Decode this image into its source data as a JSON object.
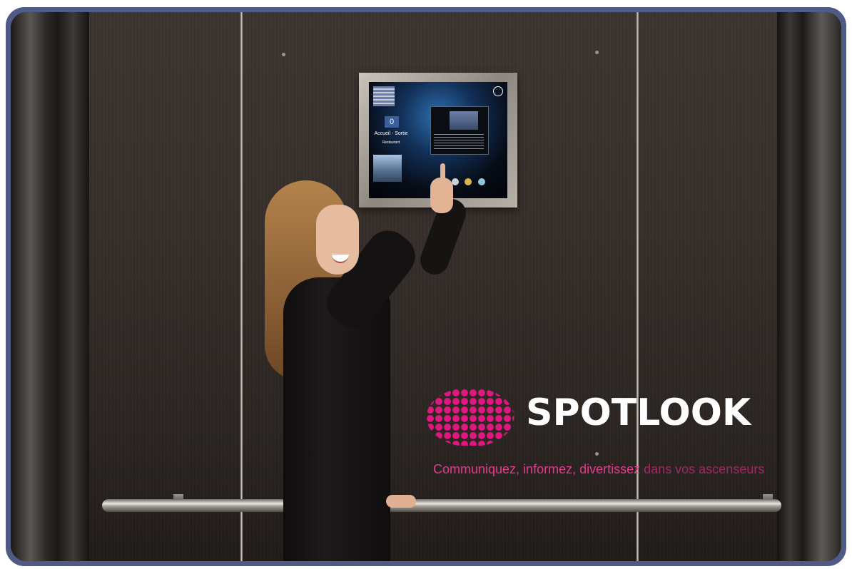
{
  "photo": {
    "description_icon": "elevator-interior-photo"
  },
  "screen": {
    "counter": "0",
    "caption": "Accueil - Sortie",
    "subcaption": "Restaurant"
  },
  "logo": {
    "wordmark": "SPOTLOOK",
    "tagline_strong": "Communiquez, informez, divertissez",
    "tagline_light": "dans vos ascenseurs"
  },
  "colors": {
    "brand_pink": "#e0177e",
    "frame_border": "#4f5b86"
  }
}
